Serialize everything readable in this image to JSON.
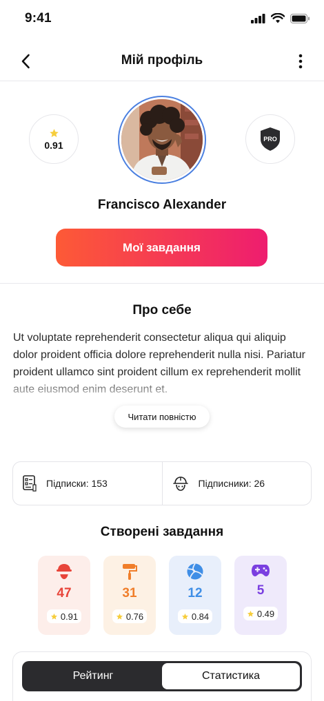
{
  "status_bar": {
    "time": "9:41"
  },
  "header": {
    "title": "Мій профіль"
  },
  "profile": {
    "rating": "0.91",
    "badge": "PRO",
    "name": "Francisco Alexander",
    "tasks_button": "Мої завдання",
    "accent_gradient": [
      "#fd5a36",
      "#ee1d6f"
    ],
    "avatar_ring_color": "#4a7fe0"
  },
  "about": {
    "title": "Про себе",
    "text": "Ut voluptate reprehenderit consectetur aliqua qui aliquip dolor proident officia dolore reprehenderit nulla nisi. Pariatur proident ullamco sint proident cillum ex reprehenderit mollit aute eiusmod enim deserunt et.",
    "read_more": "Читати повністю"
  },
  "subs": {
    "subscriptions": "Підписки: 153",
    "followers": "Підписники: 26"
  },
  "created": {
    "title": "Створені завдання",
    "categories": [
      {
        "icon": "worker-helmet-icon",
        "count": "47",
        "rating": "0.91",
        "color": "#e8453a",
        "bg": "#fdeeea"
      },
      {
        "icon": "paint-roller-icon",
        "count": "31",
        "rating": "0.76",
        "color": "#f07e2a",
        "bg": "#fdf1e4"
      },
      {
        "icon": "volleyball-icon",
        "count": "12",
        "rating": "0.84",
        "color": "#3f8ee6",
        "bg": "#e8effb"
      },
      {
        "icon": "gamepad-icon",
        "count": "5",
        "rating": "0.49",
        "color": "#7a3fe0",
        "bg": "#efeafb"
      }
    ]
  },
  "tabs": {
    "rating": "Рейтинг",
    "statistics": "Статистика"
  }
}
